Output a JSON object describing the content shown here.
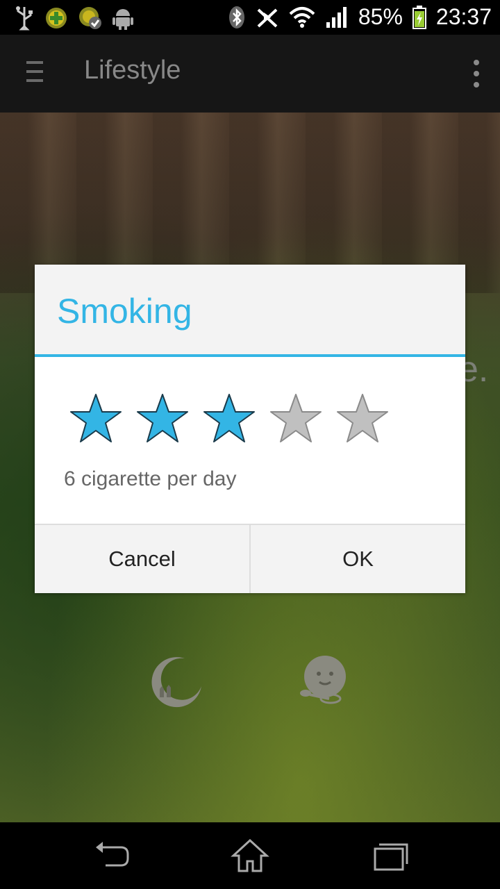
{
  "status_bar": {
    "battery_percent": "85%",
    "time": "23:37",
    "icons": [
      "usb-icon",
      "app-icon-green",
      "app-icon-check",
      "android-debug-icon",
      "bluetooth-icon",
      "nfc-icon",
      "wifi-icon",
      "signal-icon",
      "battery-charging-icon"
    ]
  },
  "action_bar": {
    "title": "Lifestyle"
  },
  "background": {
    "partial_text": "e.",
    "icons": [
      "moon-cats-icon",
      "baby-face-icon"
    ]
  },
  "dialog": {
    "title": "Smoking",
    "rating": {
      "value": 3,
      "max": 5
    },
    "description": "6 cigarette per day",
    "cancel_label": "Cancel",
    "ok_label": "OK"
  },
  "colors": {
    "accent": "#33b5e5",
    "star_inactive": "#c0c0c0"
  },
  "nav_bar": {
    "icons": [
      "back-icon",
      "home-icon",
      "recent-apps-icon"
    ]
  }
}
